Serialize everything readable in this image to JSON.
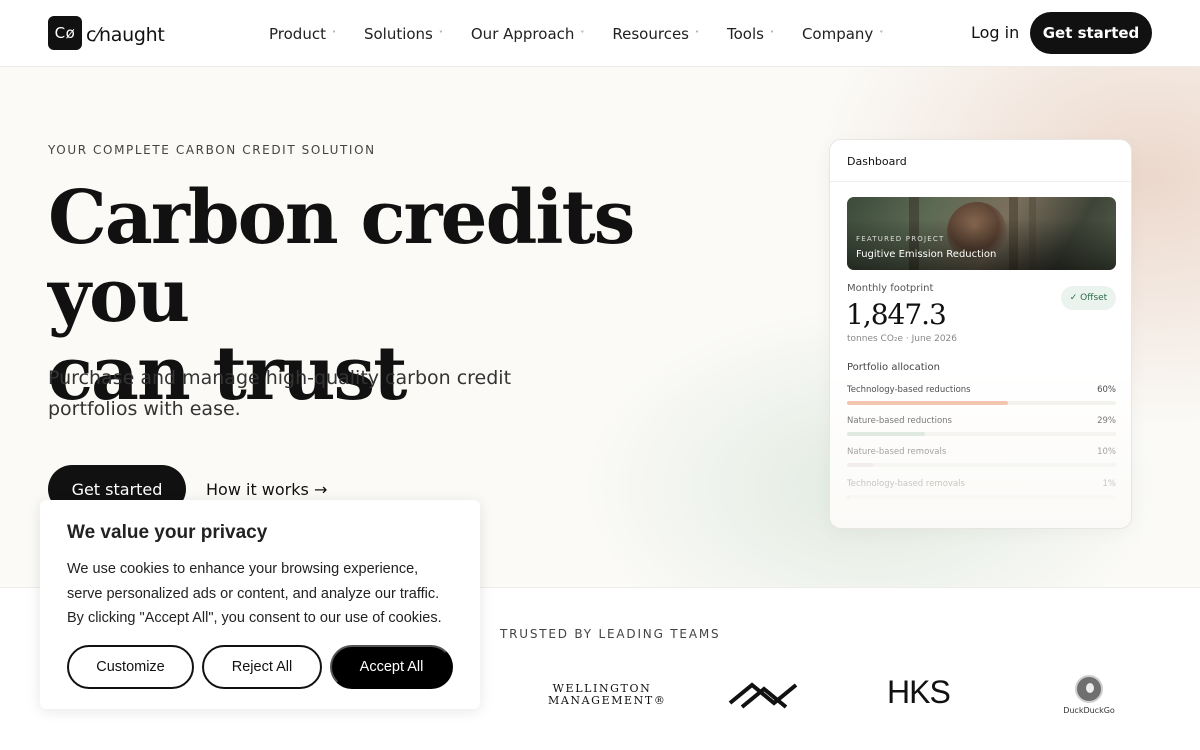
{
  "brand": {
    "mark": "Cø",
    "name": "c⁄naught"
  },
  "nav": {
    "items": [
      {
        "label": "Product"
      },
      {
        "label": "Solutions"
      },
      {
        "label": "Our Approach"
      },
      {
        "label": "Resources"
      },
      {
        "label": "Tools"
      },
      {
        "label": "Company"
      }
    ],
    "chevron": "˅",
    "login": "Log in",
    "cta": "Get started"
  },
  "hero": {
    "eyebrow": "YOUR COMPLETE CARBON CREDIT SOLUTION",
    "headline_line1": "Carbon credits you",
    "headline_line2": "can trust",
    "subhead": "Purchase and manage high-quality carbon credit portfolios with ease.",
    "cta": "Get started",
    "link": "How it works →"
  },
  "dashboard": {
    "title": "Dashboard",
    "featured_tag": "FEATURED PROJECT",
    "featured_name": "Fugitive Emission Reduction",
    "footprint_label": "Monthly footprint",
    "badge": "✓ Offset",
    "footprint_value": "1,847.3",
    "footprint_sub": "tonnes CO₂e · June 2026",
    "allocation_title": "Portfolio allocation",
    "allocation": [
      {
        "label": "Technology-based reductions",
        "pct_text": "60%",
        "value": 60,
        "color": "#f0b69a"
      },
      {
        "label": "Nature-based reductions",
        "pct_text": "29%",
        "value": 29,
        "color": "#c9dccd"
      },
      {
        "label": "Nature-based removals",
        "pct_text": "10%",
        "value": 10,
        "color": "#e9d6de"
      },
      {
        "label": "Technology-based removals",
        "pct_text": "1%",
        "value": 1,
        "color": "#d8d2e6"
      }
    ]
  },
  "trusted": {
    "title": "TRUSTED BY LEADING TEAMS",
    "logos": {
      "wellington_line1": "WELLINGTON",
      "wellington_line2": "MANAGEMENT®",
      "hks": "HKS",
      "ddg": "DuckDuckGo"
    }
  },
  "cookie": {
    "title": "We value your privacy",
    "text": "We use cookies to enhance your browsing experience, serve personalized ads or content, and analyze our traffic. By clicking \"Accept All\", you consent to our use of cookies.",
    "customize": "Customize",
    "reject": "Reject All",
    "accept": "Accept All"
  }
}
